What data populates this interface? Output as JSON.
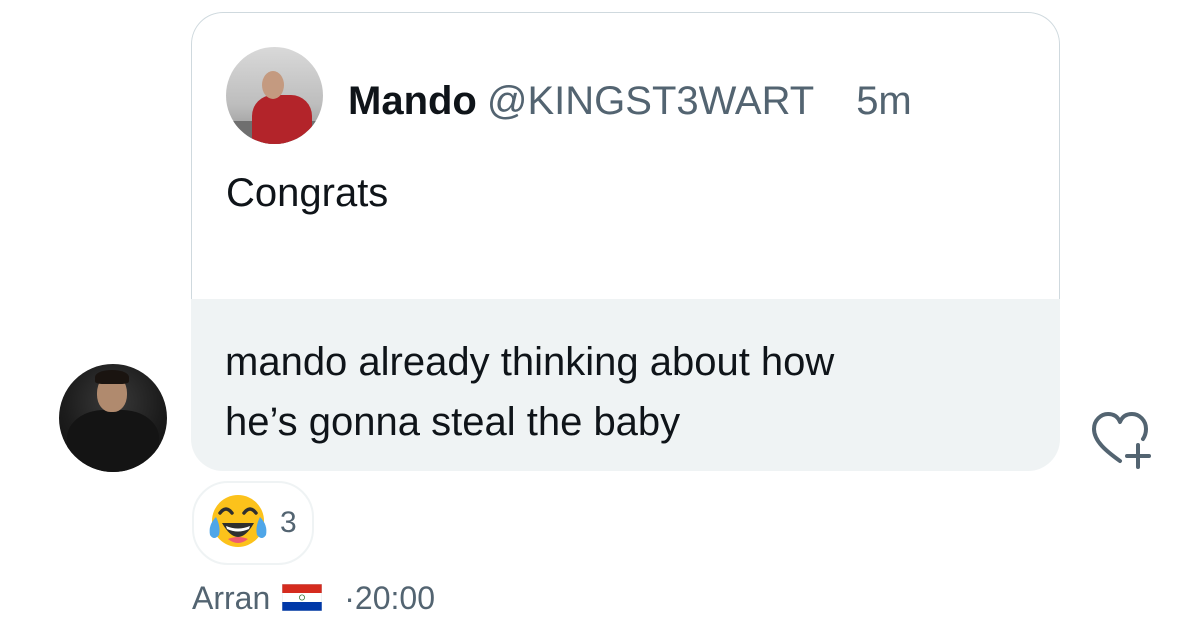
{
  "quoted_tweet": {
    "name": "Mando",
    "handle": "@KINGST3WART",
    "time": "5m",
    "text": "Congrats"
  },
  "message": {
    "line1": "mando already thinking about how",
    "line2": "he’s gonna steal the baby"
  },
  "reaction": {
    "emoji_icon": "face-with-tears-of-joy-icon",
    "count": "3"
  },
  "meta": {
    "sender": "Arran",
    "flag_icon": "paraguay-flag-icon",
    "separator": "·",
    "time": "20:00"
  },
  "colors": {
    "bubble_bg": "#eff3f4",
    "border": "#cfd9de",
    "text_primary": "#0f1419",
    "text_secondary": "#536471"
  }
}
